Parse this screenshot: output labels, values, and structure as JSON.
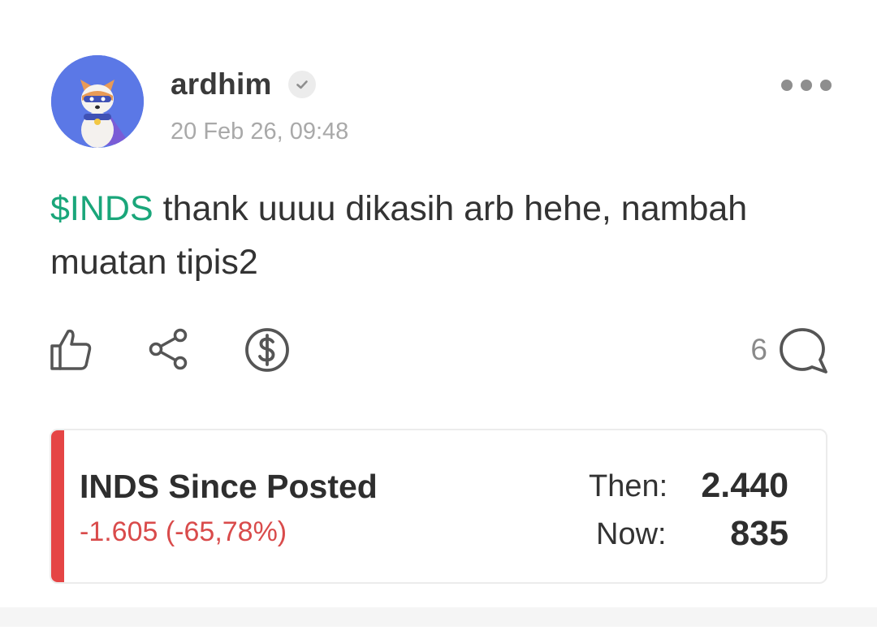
{
  "post": {
    "author": {
      "username": "ardhim",
      "verified_icon": "check-icon",
      "avatar_icon": "dog-avatar"
    },
    "timestamp": "20 Feb 26, 09:48",
    "body": {
      "cashtag": "$INDS",
      "text": " thank uuuu dikasih arb hehe, nambah muatan tipis2"
    },
    "actions": {
      "like_icon": "thumbs-up-icon",
      "share_icon": "share-icon",
      "tip_icon": "dollar-icon",
      "comment_icon": "comment-icon",
      "comment_count": "6"
    },
    "stock_card": {
      "title": "INDS Since Posted",
      "change": "-1.605 (-65,78%)",
      "then_label": "Then:",
      "then_value": "2.440",
      "now_label": "Now:",
      "now_value": "835",
      "accent_color": "#e54545"
    }
  },
  "colors": {
    "cashtag": "#1aa67a",
    "negative": "#d94b4b",
    "avatar_bg": "#5b78e6"
  }
}
